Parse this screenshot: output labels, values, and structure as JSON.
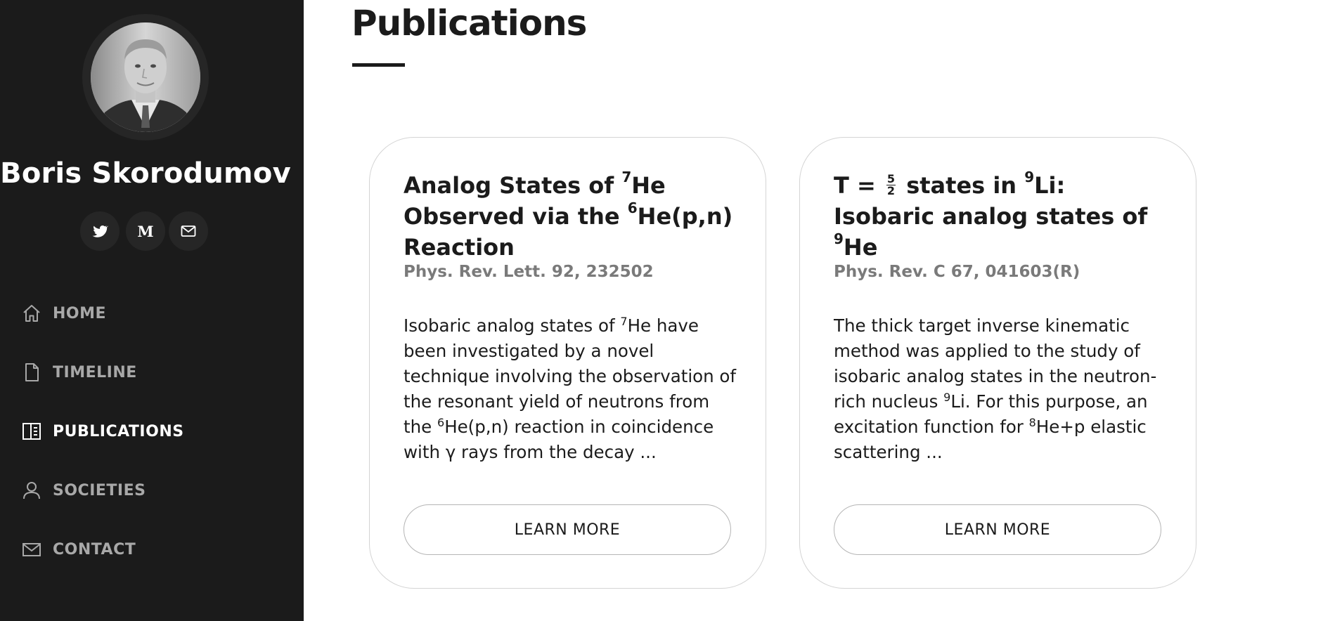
{
  "profile": {
    "name": "Boris Skorodumov",
    "avatar_alt": "profile photo"
  },
  "social": [
    {
      "name": "twitter",
      "icon": "twitter-icon"
    },
    {
      "name": "medium",
      "icon": "medium-icon",
      "glyph": "M"
    },
    {
      "name": "email",
      "icon": "mail-icon"
    }
  ],
  "nav": {
    "items": [
      {
        "label": "HOME",
        "icon": "home-icon",
        "active": false
      },
      {
        "label": "TIMELINE",
        "icon": "document-icon",
        "active": false
      },
      {
        "label": "PUBLICATIONS",
        "icon": "book-icon",
        "active": true
      },
      {
        "label": "SOCIETIES",
        "icon": "person-icon",
        "active": false
      },
      {
        "label": "CONTACT",
        "icon": "mail-icon",
        "active": false
      }
    ]
  },
  "main": {
    "title": "Publications",
    "cards": [
      {
        "title": {
          "t1": "Analog States of ",
          "sup1": "7",
          "t2": "He Observed via the ",
          "sup2": "6",
          "t3": "He(p,n) Reaction"
        },
        "journal": "Phys. Rev. Lett. 92, 232502",
        "abstract": {
          "a1": "Isobaric analog states of ",
          "sup1": "7",
          "a2": "He have been investigated by a novel technique involving the observation of the resonant yield of neutrons from the ",
          "sup2": "6",
          "a3": "He(p,n) reaction in coincidence with γ rays from the decay ..."
        },
        "button": "LEARN MORE"
      },
      {
        "title": {
          "t1": "T = ",
          "frac_num": "5",
          "frac_den": "2",
          "t2": " states in ",
          "sup1": "9",
          "t3": "Li: Isobaric analog states of ",
          "sup2": "9",
          "t4": "He"
        },
        "journal": "Phys. Rev. C 67, 041603(R)",
        "abstract": {
          "a1": "The thick target inverse kinematic method was applied to the study of isobaric analog states in the neutron-rich nucleus ",
          "sup1": "9",
          "a2": "Li. For this purpose, an excitation function for ",
          "sup2": "8",
          "a3": "He+p elastic scattering ..."
        },
        "button": "LEARN MORE"
      }
    ]
  },
  "colors": {
    "sidebar_bg": "#1b1b1b",
    "nav_inactive": "#a8a8a8",
    "nav_active": "#ffffff",
    "journal": "#7a7a7a",
    "card_border": "#d4d4d4"
  }
}
